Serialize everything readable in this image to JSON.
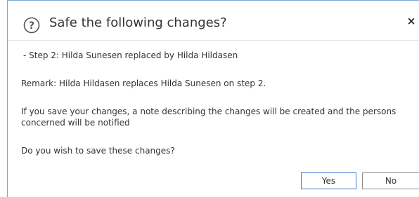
{
  "dialog": {
    "title": "Safe the following changes?",
    "help_icon": "question-mark-circle-icon",
    "close_label": "×",
    "change_line": " - Step 2: Hilda Sunesen replaced by Hilda Hildasen",
    "remark": "Remark: Hilda Hildasen replaces Hilda Sunesen on step 2.",
    "info": "If you save your changes, a note describing the changes will be created and the persons concerned will be notified",
    "question": "Do you wish to save these changes?",
    "buttons": {
      "yes": "Yes",
      "no": "No"
    }
  },
  "colors": {
    "border_accent": "#7aa7d6",
    "primary_button_border": "#3a78c4",
    "text": "#333333"
  }
}
